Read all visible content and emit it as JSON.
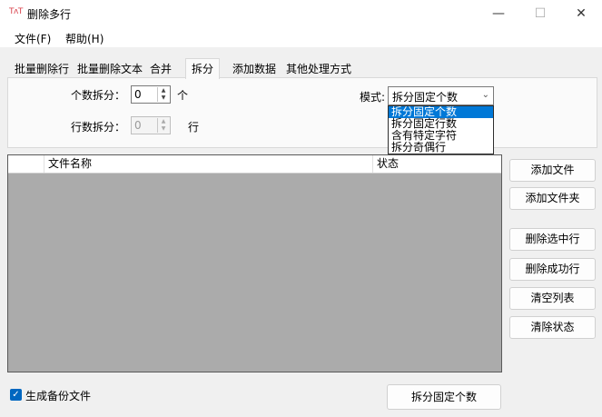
{
  "window": {
    "icon_text": "TʌT",
    "title": "删除多行",
    "minimize": "—",
    "maximize": "☐",
    "close": "✕"
  },
  "menu": [
    {
      "label": "文件(F)"
    },
    {
      "label": "帮助(H)"
    }
  ],
  "tabs": [
    {
      "label": "批量删除行"
    },
    {
      "label": "批量删除文本"
    },
    {
      "label": "合并"
    },
    {
      "label": "拆分",
      "active": true
    },
    {
      "label": "添加数据"
    },
    {
      "label": "其他处理方式"
    }
  ],
  "split_panel": {
    "count_label": "个数拆分：",
    "count_value": "0",
    "count_unit": "个",
    "rows_label": "行数拆分：",
    "rows_value": "0",
    "rows_unit": "行",
    "mode_label": "模式:",
    "mode_value": "拆分固定个数",
    "mode_options": [
      "拆分固定个数",
      "拆分固定行数",
      "含有特定字符",
      "拆分奇偶行"
    ],
    "mode_selected_index": 0
  },
  "file_table": {
    "columns": [
      "",
      "文件名称",
      "状态"
    ],
    "rows": []
  },
  "side_buttons": {
    "add_file": "添加文件",
    "add_folder": "添加文件夹",
    "delete_selected": "删除选中行",
    "delete_success": "删除成功行",
    "clear_list": "清空列表",
    "clear_status": "清除状态"
  },
  "footer": {
    "backup_label": "生成备份文件",
    "backup_checked": true,
    "run_button": "拆分固定个数"
  },
  "colors": {
    "accent": "#0078d7",
    "checkbox": "#0067c0",
    "grid_background": "#ababab"
  }
}
